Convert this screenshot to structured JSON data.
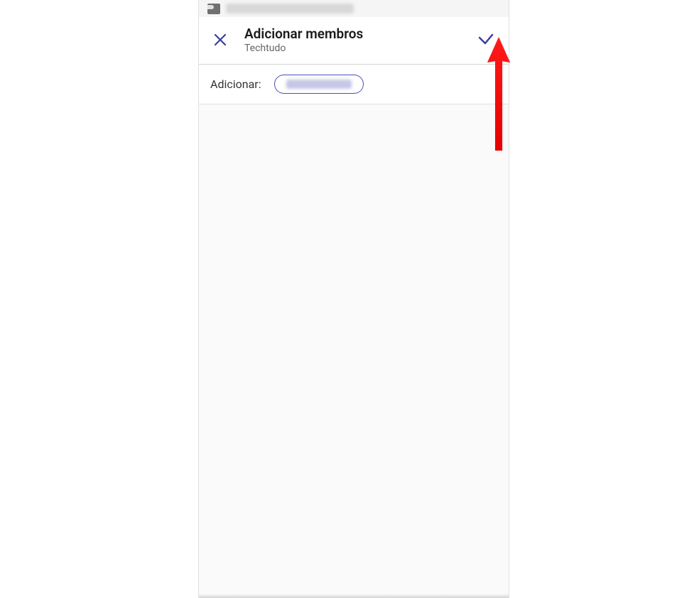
{
  "notification": {
    "icon_name": "image-icon"
  },
  "header": {
    "title": "Adicionar membros",
    "subtitle": "Techtudo",
    "close_icon": "close-icon",
    "confirm_icon": "checkmark-icon"
  },
  "add_section": {
    "label": "Adicionar:"
  },
  "colors": {
    "accent": "#3a3f9c",
    "arrow": "#ff0000"
  }
}
